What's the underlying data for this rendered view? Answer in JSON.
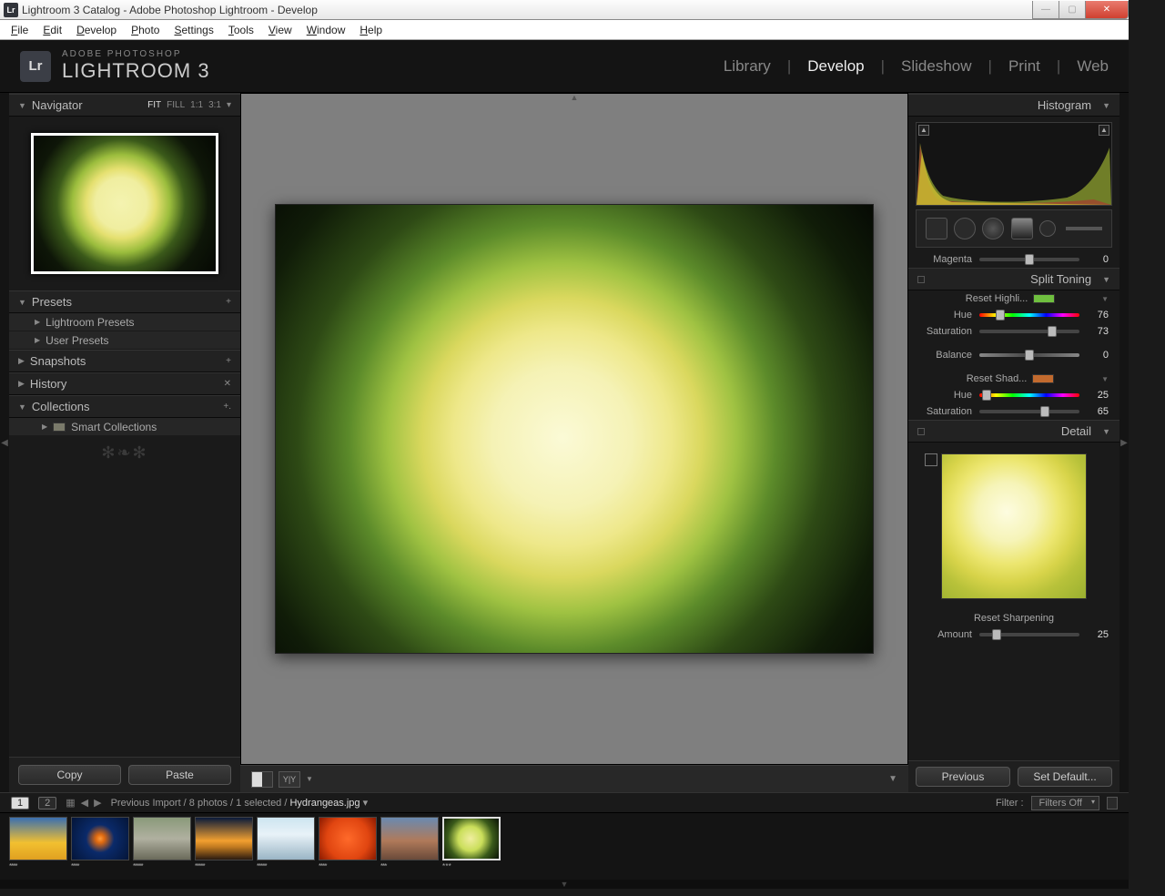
{
  "window": {
    "title": "Lightroom 3 Catalog - Adobe Photoshop Lightroom - Develop"
  },
  "menubar": [
    "File",
    "Edit",
    "Develop",
    "Photo",
    "Settings",
    "Tools",
    "View",
    "Window",
    "Help"
  ],
  "brand": {
    "sup": "ADOBE PHOTOSHOP",
    "name": "LIGHTROOM 3",
    "logo": "Lr"
  },
  "modules": {
    "items": [
      "Library",
      "Develop",
      "Slideshow",
      "Print",
      "Web"
    ],
    "active": "Develop"
  },
  "left": {
    "navigator": {
      "title": "Navigator",
      "fit": "FIT",
      "fill": "FILL",
      "r1": "1:1",
      "r2": "3:1"
    },
    "presets": {
      "title": "Presets",
      "items": [
        "Lightroom Presets",
        "User Presets"
      ]
    },
    "snapshots": {
      "title": "Snapshots"
    },
    "history": {
      "title": "History"
    },
    "collections": {
      "title": "Collections",
      "items": [
        "Smart Collections"
      ]
    },
    "copy": "Copy",
    "paste": "Paste"
  },
  "right": {
    "histogram": {
      "title": "Histogram"
    },
    "magenta": {
      "label": "Magenta",
      "value": "0"
    },
    "splitToning": {
      "title": "Split Toning",
      "highlights": {
        "label": "Reset Highli...",
        "swatch": "#6fbf3f",
        "hueLbl": "Hue",
        "hue": "76",
        "satLbl": "Saturation",
        "sat": "73"
      },
      "balance": {
        "label": "Balance",
        "value": "0"
      },
      "shadows": {
        "label": "Reset Shad...",
        "swatch": "#c26a2e",
        "hueLbl": "Hue",
        "hue": "25",
        "satLbl": "Saturation",
        "sat": "65"
      }
    },
    "detail": {
      "title": "Detail",
      "sharpening": "Reset Sharpening",
      "amountLbl": "Amount",
      "amount": "25"
    },
    "prev": "Previous",
    "setdef": "Set Default..."
  },
  "filmstrip": {
    "page1": "1",
    "page2": "2",
    "breadcrumb": "Previous Import / 8 photos / 1 selected /",
    "filename": "Hydrangeas.jpg",
    "filterLbl": "Filter :",
    "filterVal": "Filters Off",
    "thumbs": [
      {
        "bg": "linear-gradient(to bottom,#3a6fb0 0%,#f2c030 60%,#e0a020 100%)",
        "stars": "****"
      },
      {
        "bg": "radial-gradient(circle at 50% 50%, #ff9a3a 0%, #e06a10 12%, #0a2a6a 40%, #041538 100%)",
        "stars": "****"
      },
      {
        "bg": "linear-gradient(to bottom,#8a9a7a 0%,#b0b0a0 50%,#6a6a5a 100%)",
        "stars": "*****"
      },
      {
        "bg": "linear-gradient(to bottom,#0a1a3a 0%,#f2a030 55%,#c07a20 70%,#2a1a10 100%)",
        "stars": "*****"
      },
      {
        "bg": "linear-gradient(to bottom,#cde5f0 0%, #e8f2f8 40%, #9ab5c5 100%)",
        "stars": "*****"
      },
      {
        "bg": "radial-gradient(circle at 50% 50%,#ff6a2a 0%,#e04510 60%,#8a1a00 100%)",
        "stars": "****"
      },
      {
        "bg": "linear-gradient(to bottom,#6a8ab0 0%,#b07a5a 55%,#6a4a3a 100%)",
        "stars": "***"
      },
      {
        "bg": "radial-gradient(circle at 48% 50%,#f0eea0 0%,#cade5a 35%,#3a5a1a 65%,#0a1205 100%)",
        "stars": "* * *",
        "selected": true
      }
    ]
  }
}
